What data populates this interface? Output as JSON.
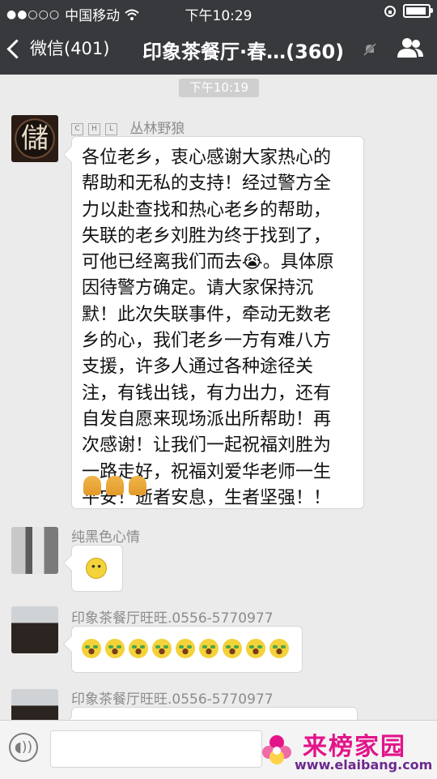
{
  "status_bar": {
    "carrier": "中国移动",
    "time": "下午10:29"
  },
  "nav": {
    "back_label": "微信(401)",
    "title": "印象茶餐厅·春…(360)"
  },
  "chat": {
    "time_divider": "下午10:19",
    "messages": [
      {
        "sender": "丛林野狼",
        "sender_tags": [
          "C",
          "H",
          "L"
        ],
        "avatar_text": "儲",
        "text": "各位老乡，衷心感谢大家热心的\n帮助和无私的支持！经过警方全\n力以赴查找和热心老乡的帮助，\n失联的老乡刘胜为终于找到了，\n可他已经离我们而去😭。具体原\n因待警方确定。请大家保持沉\n默！此次失联事件，牵动无数老\n乡的心，我们老乡一方有难八方\n支援，许多人通过各种途径关\n注，有钱出钱，有力出力，还有\n自发自愿来现场派出所帮助！再\n次感谢！让我们一起祝福刘胜为\n一路走好，祝福刘爱华老师一生\n平安！逝者安息，生者坚强！！",
        "emoji_line": [
          "pray",
          "pray",
          "pray"
        ]
      },
      {
        "sender": "纯黑色心情",
        "emoji": "face"
      },
      {
        "sender": "印象茶餐厅旺旺.0556-5770977",
        "emojis": [
          "cry",
          "cry",
          "cry",
          "cry",
          "cry",
          "cry",
          "cry",
          "cry",
          "cry"
        ]
      },
      {
        "sender": "印象茶餐厅旺旺.0556-5770977"
      }
    ]
  },
  "watermark": {
    "title": "来榜家园",
    "url": "www.elaibang.com"
  },
  "icons": [
    "signal-dots-icon",
    "wifi-icon",
    "rotation-lock-icon",
    "battery-icon",
    "back-chevron-icon",
    "mute-icon",
    "group-members-icon",
    "voice-icon"
  ]
}
